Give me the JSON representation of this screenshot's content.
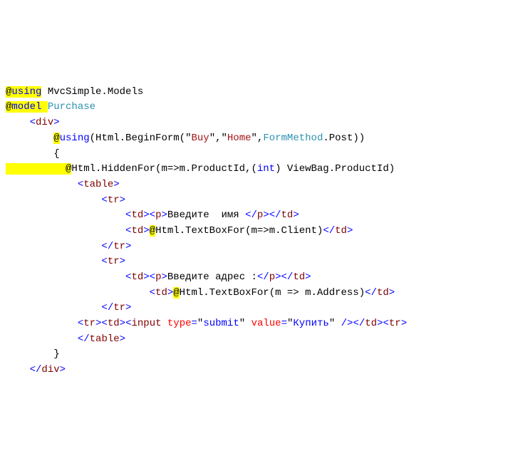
{
  "l1": {
    "at": "@",
    "using": "using",
    "ns": " MvcSimple.Models"
  },
  "l2": {
    "at": "@",
    "model": "model",
    "sp": " ",
    "type": "Purchase"
  },
  "l3": {
    "i": "    ",
    "o": "<",
    "div": "div",
    "c": ">"
  },
  "l4": {
    "i": "        ",
    "at": "@",
    "using": "using",
    "p1": "(Html.BeginForm(",
    "q": "\"",
    "buy": "Buy",
    "c1": ",",
    "home": "Home",
    "c2": ",",
    "fm": "FormMethod",
    "post": ".Post))"
  },
  "l5": {
    "i": "        ",
    "brace": "{"
  },
  "l6": {
    "pad": "          ",
    "at": "@",
    "txt1": "Html.HiddenFor(m=>m.ProductId,(",
    "int": "int",
    "txt2": ") ViewBag.ProductId)"
  },
  "l7": {
    "i": "            ",
    "o": "<",
    "t": "table",
    "c": ">"
  },
  "l8": {
    "i": "                ",
    "o": "<",
    "t": "tr",
    "c": ">"
  },
  "l9": {
    "i": "                    ",
    "o1": "<",
    "td": "td",
    "c1": ">",
    "o2": "<",
    "p": "p",
    "c2": ">",
    "txt": "Введите  имя ",
    "o3": "</",
    "c3": ">",
    "o4": "</",
    "c4": ">"
  },
  "l10": {
    "i": "                    ",
    "o": "<",
    "td": "td",
    "c": ">",
    "at": "@",
    "expr": "Html.TextBoxFor(m=>m.Client)",
    "o2": "</",
    "c2": ">"
  },
  "l11": {
    "i": "                ",
    "o": "</",
    "t": "tr",
    "c": ">"
  },
  "l12": {
    "i": "                ",
    "o": "<",
    "t": "tr",
    "c": ">"
  },
  "l13": {
    "i": "                    ",
    "o1": "<",
    "td": "td",
    "c1": ">",
    "o2": "<",
    "p": "p",
    "c2": ">",
    "txt": "Введите адрес :",
    "o3": "</",
    "c3": ">",
    "o4": "</",
    "c4": ">"
  },
  "l14": {
    "i": "                        ",
    "o": "<",
    "td": "td",
    "c": ">",
    "at": "@",
    "expr": "Html.TextBoxFor(m => m.Address)",
    "o2": "</",
    "c2": ">"
  },
  "l15": {
    "i": "                ",
    "o": "</",
    "t": "tr",
    "c": ">"
  },
  "l16": {
    "i": "            ",
    "o1": "<",
    "tr": "tr",
    "c1": ">",
    "o2": "<",
    "td": "td",
    "c2": ">",
    "o3": "<",
    "input": "input",
    "sp": " ",
    "type": "type",
    "eq": "=",
    "q": "\"",
    "submit": "submit",
    "sp2": " ",
    "value": "value",
    "buy": "Купить",
    "sp3": " ",
    "sl": "/>",
    "o4": "</",
    "c4": ">",
    "o5": "<"
  },
  "l17": {
    "i": "            ",
    "o": "</",
    "t": "table",
    "c": ">"
  },
  "l18": {
    "i": "        ",
    "brace": "}"
  },
  "l19": {
    "i": "    ",
    "o": "</",
    "div": "div",
    "c": ">"
  }
}
